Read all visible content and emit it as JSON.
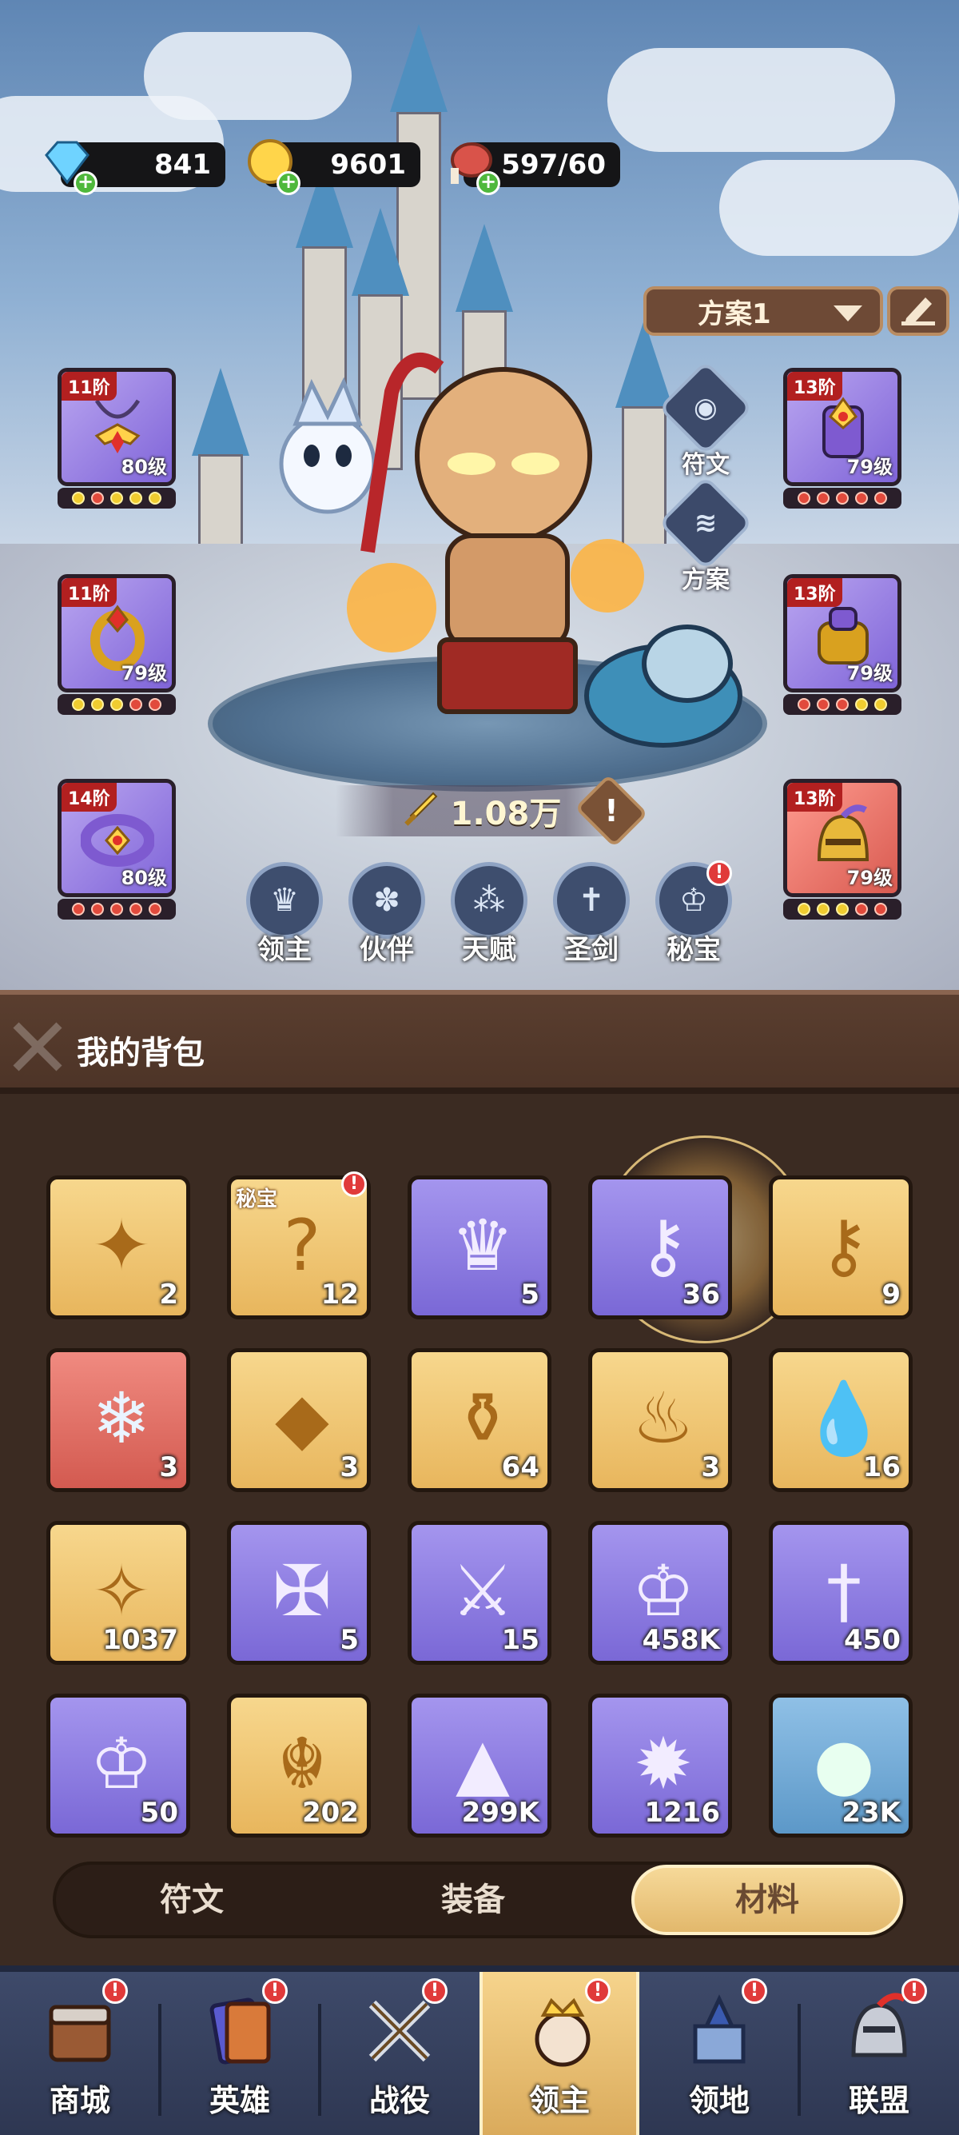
{
  "resources": {
    "diamonds": "841",
    "gold": "9601",
    "stamina": "597/60"
  },
  "preset": {
    "label": "方案1"
  },
  "side_buttons": {
    "rune": "符文",
    "preset": "方案"
  },
  "equipment": [
    {
      "tier": "11阶",
      "level": "80级",
      "dots": [
        "y",
        "r",
        "y",
        "y",
        "y"
      ]
    },
    {
      "tier": "13阶",
      "level": "79级",
      "dots": [
        "r",
        "r",
        "r",
        "r",
        "r"
      ]
    },
    {
      "tier": "11阶",
      "level": "79级",
      "dots": [
        "y",
        "y",
        "y",
        "r",
        "r"
      ]
    },
    {
      "tier": "13阶",
      "level": "79级",
      "dots": [
        "r",
        "r",
        "r",
        "y",
        "y"
      ]
    },
    {
      "tier": "14阶",
      "level": "80级",
      "dots": [
        "r",
        "r",
        "r",
        "r",
        "r"
      ]
    },
    {
      "tier": "13阶",
      "level": "79级",
      "dots": [
        "y",
        "y",
        "y",
        "r",
        "r"
      ]
    }
  ],
  "power": {
    "value": "1.08万",
    "warn": "!"
  },
  "hero_tabs": [
    "领主",
    "伙伴",
    "天赋",
    "圣剑",
    "秘宝"
  ],
  "bag": {
    "title": "我的背包",
    "items": [
      {
        "count": "2",
        "color": "gold",
        "icon": "star-compass-icon"
      },
      {
        "count": "12",
        "color": "gold",
        "icon": "mystery-puzzle-icon",
        "tag": "秘宝"
      },
      {
        "count": "5",
        "color": "purple",
        "icon": "crown-ticket-icon"
      },
      {
        "count": "36",
        "color": "purple",
        "icon": "silver-key-icon"
      },
      {
        "count": "9",
        "color": "gold",
        "icon": "gold-key-icon"
      },
      {
        "count": "3",
        "color": "red",
        "icon": "snowflake-icon"
      },
      {
        "count": "3",
        "color": "gold",
        "icon": "orange-gem-icon"
      },
      {
        "count": "64",
        "color": "gold",
        "icon": "potion-icon"
      },
      {
        "count": "3",
        "color": "gold",
        "icon": "torch-icon"
      },
      {
        "count": "16",
        "color": "gold",
        "icon": "water-drop-icon"
      },
      {
        "count": "1037",
        "color": "gold",
        "icon": "star-crystal-icon"
      },
      {
        "count": "5",
        "color": "purple",
        "icon": "treasure-map-icon"
      },
      {
        "count": "15",
        "color": "purple",
        "icon": "sword-scroll-icon"
      },
      {
        "count": "458K",
        "color": "purple",
        "icon": "crown-coin-icon"
      },
      {
        "count": "450",
        "color": "purple",
        "icon": "sword-emblem-icon"
      },
      {
        "count": "50",
        "color": "purple",
        "icon": "rainbow-crown-coin-icon"
      },
      {
        "count": "202",
        "color": "gold",
        "icon": "dragon-emblem-icon"
      },
      {
        "count": "299K",
        "color": "purple",
        "icon": "purple-sand-icon"
      },
      {
        "count": "1216",
        "color": "purple",
        "icon": "red-crystal-icon"
      },
      {
        "count": "23K",
        "color": "blue",
        "icon": "green-orb-icon"
      }
    ]
  },
  "segments": [
    "符文",
    "装备",
    "材料"
  ],
  "nav": [
    "商城",
    "英雄",
    "战役",
    "领主",
    "领地",
    "联盟"
  ],
  "badge": "!"
}
